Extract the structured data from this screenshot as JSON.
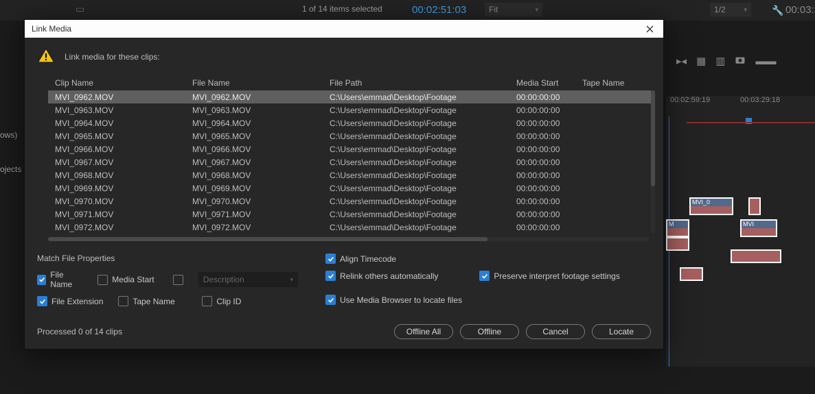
{
  "background": {
    "selection_count": "1 of 14 items selected",
    "timecode_left": "00:02:51:03",
    "fit_label": "Fit",
    "half_label": "1/2",
    "timecode_right": "00:03:3",
    "left_frag1": "ows)",
    "left_frag2": "ojects \\"
  },
  "timeline": {
    "tick1": "00:02:59:19",
    "tick2": "00:03:29:18",
    "clip_labels": {
      "c1": "MVI_0",
      "c2": "M",
      "c3": "MVI"
    }
  },
  "dialog": {
    "title": "Link Media",
    "warning": "Link media for these clips:",
    "headers": {
      "clip": "Clip Name",
      "file": "File Name",
      "path": "File Path",
      "start": "Media Start",
      "tape": "Tape Name"
    },
    "rows": [
      {
        "clip": "MVI_0962.MOV",
        "file": "MVI_0962.MOV",
        "path": "C:\\Users\\emmad\\Desktop\\Footage",
        "start": "00:00:00:00",
        "tape": ""
      },
      {
        "clip": "MVI_0963.MOV",
        "file": "MVI_0963.MOV",
        "path": "C:\\Users\\emmad\\Desktop\\Footage",
        "start": "00:00:00:00",
        "tape": ""
      },
      {
        "clip": "MVI_0964.MOV",
        "file": "MVI_0964.MOV",
        "path": "C:\\Users\\emmad\\Desktop\\Footage",
        "start": "00:00:00:00",
        "tape": ""
      },
      {
        "clip": "MVI_0965.MOV",
        "file": "MVI_0965.MOV",
        "path": "C:\\Users\\emmad\\Desktop\\Footage",
        "start": "00:00:00:00",
        "tape": ""
      },
      {
        "clip": "MVI_0966.MOV",
        "file": "MVI_0966.MOV",
        "path": "C:\\Users\\emmad\\Desktop\\Footage",
        "start": "00:00:00:00",
        "tape": ""
      },
      {
        "clip": "MVI_0967.MOV",
        "file": "MVI_0967.MOV",
        "path": "C:\\Users\\emmad\\Desktop\\Footage",
        "start": "00:00:00:00",
        "tape": ""
      },
      {
        "clip": "MVI_0968.MOV",
        "file": "MVI_0968.MOV",
        "path": "C:\\Users\\emmad\\Desktop\\Footage",
        "start": "00:00:00:00",
        "tape": ""
      },
      {
        "clip": "MVI_0969.MOV",
        "file": "MVI_0969.MOV",
        "path": "C:\\Users\\emmad\\Desktop\\Footage",
        "start": "00:00:00:00",
        "tape": ""
      },
      {
        "clip": "MVI_0970.MOV",
        "file": "MVI_0970.MOV",
        "path": "C:\\Users\\emmad\\Desktop\\Footage",
        "start": "00:00:00:00",
        "tape": ""
      },
      {
        "clip": "MVI_0971.MOV",
        "file": "MVI_0971.MOV",
        "path": "C:\\Users\\emmad\\Desktop\\Footage",
        "start": "00:00:00:00",
        "tape": ""
      },
      {
        "clip": "MVI_0972.MOV",
        "file": "MVI_0972.MOV",
        "path": "C:\\Users\\emmad\\Desktop\\Footage",
        "start": "00:00:00:00",
        "tape": ""
      }
    ],
    "match_title": "Match File Properties",
    "checks": {
      "file_name": "File Name",
      "media_start": "Media Start",
      "description_placeholder": "Description",
      "file_ext": "File Extension",
      "tape_name": "Tape Name",
      "clip_id": "Clip ID",
      "align_tc": "Align Timecode",
      "relink_auto": "Relink others automatically",
      "preserve": "Preserve interpret footage settings",
      "media_browser": "Use Media Browser to locate files"
    },
    "processed": "Processed 0 of 14 clips",
    "buttons": {
      "offline_all": "Offline All",
      "offline": "Offline",
      "cancel": "Cancel",
      "locate": "Locate"
    }
  }
}
